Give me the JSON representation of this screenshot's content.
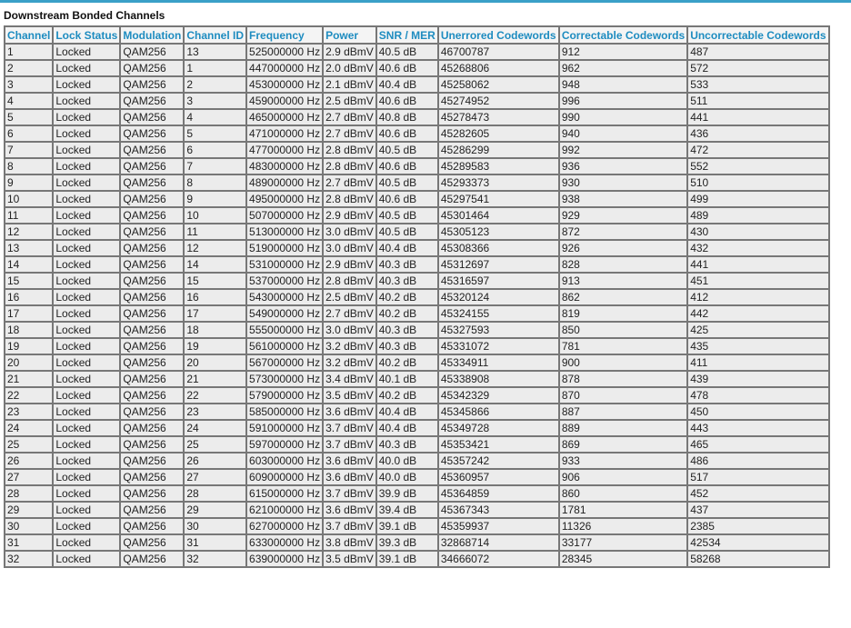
{
  "section": {
    "title": "Downstream Bonded Channels"
  },
  "table": {
    "headers": [
      "Channel",
      "Lock Status",
      "Modulation",
      "Channel ID",
      "Frequency",
      "Power",
      "SNR / MER",
      "Unerrored Codewords",
      "Correctable Codewords",
      "Uncorrectable Codewords"
    ],
    "rows": [
      [
        "1",
        "Locked",
        "QAM256",
        "13",
        "525000000 Hz",
        "2.9 dBmV",
        "40.5 dB",
        "46700787",
        "912",
        "487"
      ],
      [
        "2",
        "Locked",
        "QAM256",
        "1",
        "447000000 Hz",
        "2.0 dBmV",
        "40.6 dB",
        "45268806",
        "962",
        "572"
      ],
      [
        "3",
        "Locked",
        "QAM256",
        "2",
        "453000000 Hz",
        "2.1 dBmV",
        "40.4 dB",
        "45258062",
        "948",
        "533"
      ],
      [
        "4",
        "Locked",
        "QAM256",
        "3",
        "459000000 Hz",
        "2.5 dBmV",
        "40.6 dB",
        "45274952",
        "996",
        "511"
      ],
      [
        "5",
        "Locked",
        "QAM256",
        "4",
        "465000000 Hz",
        "2.7 dBmV",
        "40.8 dB",
        "45278473",
        "990",
        "441"
      ],
      [
        "6",
        "Locked",
        "QAM256",
        "5",
        "471000000 Hz",
        "2.7 dBmV",
        "40.6 dB",
        "45282605",
        "940",
        "436"
      ],
      [
        "7",
        "Locked",
        "QAM256",
        "6",
        "477000000 Hz",
        "2.8 dBmV",
        "40.5 dB",
        "45286299",
        "992",
        "472"
      ],
      [
        "8",
        "Locked",
        "QAM256",
        "7",
        "483000000 Hz",
        "2.8 dBmV",
        "40.6 dB",
        "45289583",
        "936",
        "552"
      ],
      [
        "9",
        "Locked",
        "QAM256",
        "8",
        "489000000 Hz",
        "2.7 dBmV",
        "40.5 dB",
        "45293373",
        "930",
        "510"
      ],
      [
        "10",
        "Locked",
        "QAM256",
        "9",
        "495000000 Hz",
        "2.8 dBmV",
        "40.6 dB",
        "45297541",
        "938",
        "499"
      ],
      [
        "11",
        "Locked",
        "QAM256",
        "10",
        "507000000 Hz",
        "2.9 dBmV",
        "40.5 dB",
        "45301464",
        "929",
        "489"
      ],
      [
        "12",
        "Locked",
        "QAM256",
        "11",
        "513000000 Hz",
        "3.0 dBmV",
        "40.5 dB",
        "45305123",
        "872",
        "430"
      ],
      [
        "13",
        "Locked",
        "QAM256",
        "12",
        "519000000 Hz",
        "3.0 dBmV",
        "40.4 dB",
        "45308366",
        "926",
        "432"
      ],
      [
        "14",
        "Locked",
        "QAM256",
        "14",
        "531000000 Hz",
        "2.9 dBmV",
        "40.3 dB",
        "45312697",
        "828",
        "441"
      ],
      [
        "15",
        "Locked",
        "QAM256",
        "15",
        "537000000 Hz",
        "2.8 dBmV",
        "40.3 dB",
        "45316597",
        "913",
        "451"
      ],
      [
        "16",
        "Locked",
        "QAM256",
        "16",
        "543000000 Hz",
        "2.5 dBmV",
        "40.2 dB",
        "45320124",
        "862",
        "412"
      ],
      [
        "17",
        "Locked",
        "QAM256",
        "17",
        "549000000 Hz",
        "2.7 dBmV",
        "40.2 dB",
        "45324155",
        "819",
        "442"
      ],
      [
        "18",
        "Locked",
        "QAM256",
        "18",
        "555000000 Hz",
        "3.0 dBmV",
        "40.3 dB",
        "45327593",
        "850",
        "425"
      ],
      [
        "19",
        "Locked",
        "QAM256",
        "19",
        "561000000 Hz",
        "3.2 dBmV",
        "40.3 dB",
        "45331072",
        "781",
        "435"
      ],
      [
        "20",
        "Locked",
        "QAM256",
        "20",
        "567000000 Hz",
        "3.2 dBmV",
        "40.2 dB",
        "45334911",
        "900",
        "411"
      ],
      [
        "21",
        "Locked",
        "QAM256",
        "21",
        "573000000 Hz",
        "3.4 dBmV",
        "40.1 dB",
        "45338908",
        "878",
        "439"
      ],
      [
        "22",
        "Locked",
        "QAM256",
        "22",
        "579000000 Hz",
        "3.5 dBmV",
        "40.2 dB",
        "45342329",
        "870",
        "478"
      ],
      [
        "23",
        "Locked",
        "QAM256",
        "23",
        "585000000 Hz",
        "3.6 dBmV",
        "40.4 dB",
        "45345866",
        "887",
        "450"
      ],
      [
        "24",
        "Locked",
        "QAM256",
        "24",
        "591000000 Hz",
        "3.7 dBmV",
        "40.4 dB",
        "45349728",
        "889",
        "443"
      ],
      [
        "25",
        "Locked",
        "QAM256",
        "25",
        "597000000 Hz",
        "3.7 dBmV",
        "40.3 dB",
        "45353421",
        "869",
        "465"
      ],
      [
        "26",
        "Locked",
        "QAM256",
        "26",
        "603000000 Hz",
        "3.6 dBmV",
        "40.0 dB",
        "45357242",
        "933",
        "486"
      ],
      [
        "27",
        "Locked",
        "QAM256",
        "27",
        "609000000 Hz",
        "3.6 dBmV",
        "40.0 dB",
        "45360957",
        "906",
        "517"
      ],
      [
        "28",
        "Locked",
        "QAM256",
        "28",
        "615000000 Hz",
        "3.7 dBmV",
        "39.9 dB",
        "45364859",
        "860",
        "452"
      ],
      [
        "29",
        "Locked",
        "QAM256",
        "29",
        "621000000 Hz",
        "3.6 dBmV",
        "39.4 dB",
        "45367343",
        "1781",
        "437"
      ],
      [
        "30",
        "Locked",
        "QAM256",
        "30",
        "627000000 Hz",
        "3.7 dBmV",
        "39.1 dB",
        "45359937",
        "11326",
        "2385"
      ],
      [
        "31",
        "Locked",
        "QAM256",
        "31",
        "633000000 Hz",
        "3.8 dBmV",
        "39.3 dB",
        "32868714",
        "33177",
        "42534"
      ],
      [
        "32",
        "Locked",
        "QAM256",
        "32",
        "639000000 Hz",
        "3.5 dBmV",
        "39.1 dB",
        "34666072",
        "28345",
        "58268"
      ]
    ]
  },
  "colors": {
    "header_text": "#1e8cc0",
    "accent_bar": "#3aa0c8",
    "cell_background": "#ececec",
    "border": "#777777"
  }
}
